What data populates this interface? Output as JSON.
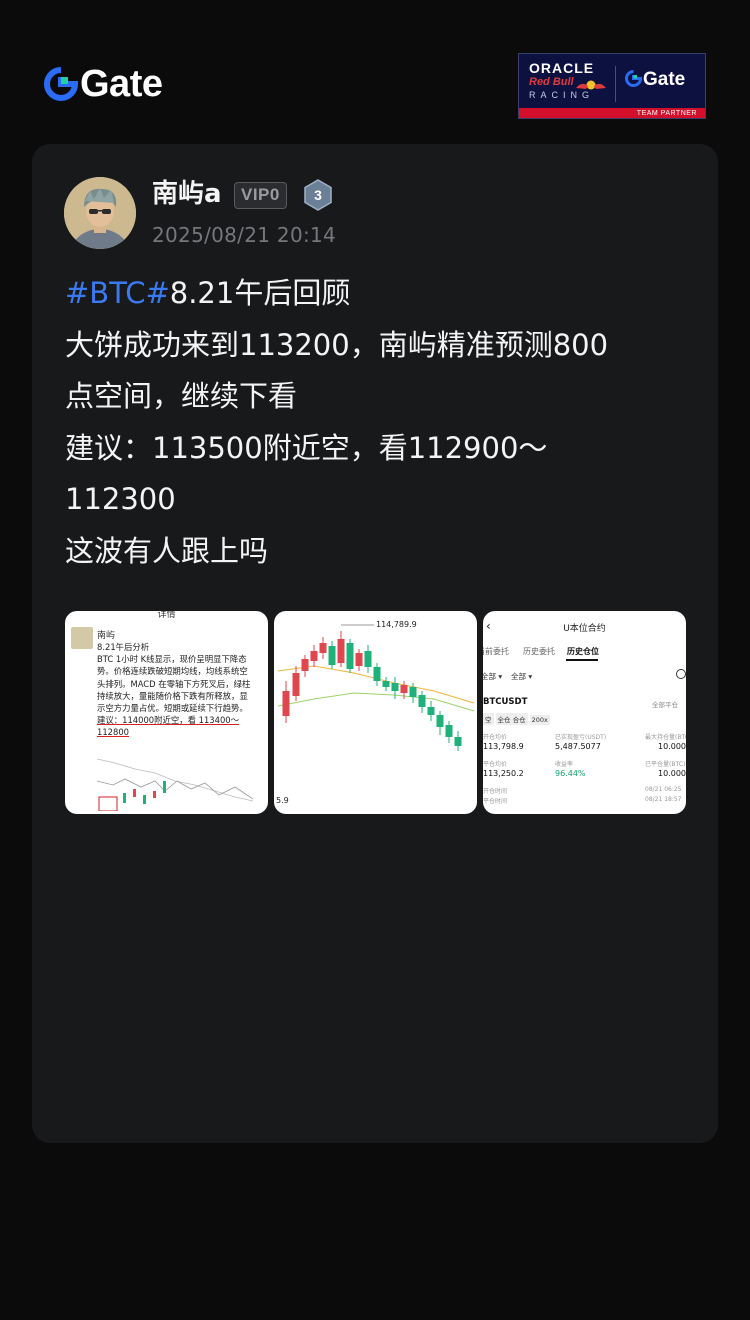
{
  "header": {
    "brand": "Gate",
    "partner": {
      "oracle": "ORACLE",
      "redbull": "Red Bull",
      "racing": "RACING",
      "gate": "Gate",
      "caption": "TEAM PARTNER"
    }
  },
  "post": {
    "username": "南屿a",
    "vip": "VIP0",
    "level": "3",
    "timestamp": "2025/08/21 20:14",
    "hashtag": "#BTC#",
    "lines": [
      "8.21午后回顾",
      "大饼成功来到113200，南屿精准预测800",
      "点空间，继续下看",
      "建议：113500附近空，看112900～",
      "112300",
      "这波有人跟上吗"
    ]
  },
  "thumbs": {
    "t1": {
      "top": "详情",
      "name": "南屿",
      "body_lines": [
        "8.21午后分析",
        "BTC 1小时 K线显示，现价呈明显下降态",
        "势。价格连续跌破短期均线，均线系统空",
        "头排列。MACD 在零轴下方死叉后，绿柱",
        "持续放大，量能随价格下跌有所释放，显",
        "示空方力量占优。短期或延续下行趋势。"
      ],
      "advice": "建议：114000附近空，看 113400～",
      "advice2": "112800"
    },
    "t2": {
      "peak": "114,789.9",
      "low": "5.9"
    },
    "t3": {
      "back": "‹",
      "title": "U本位合约",
      "tabs": [
        "当前委托",
        "历史委托",
        "历史仓位"
      ],
      "filters": [
        "全部 ▾",
        "全部 ▾"
      ],
      "fav": "全部平仓",
      "symbol": "BTCUSDT",
      "tags": [
        "空",
        "全仓 合仓",
        "200x"
      ],
      "labels": [
        "开仓均价",
        "已实现盈亏(USDT)",
        "最大持仓量(BTC)",
        "平仓均价",
        "收益率",
        "已平仓量(BTC)",
        "开仓时间",
        "平仓时间"
      ],
      "values": [
        "113,798.9",
        "5,487.5077",
        "10.000",
        "113,250.2",
        "96.44%",
        "10.000",
        "08/21 06:25",
        "08/21 18:57"
      ]
    }
  },
  "colors": {
    "background": "#0b0b0c",
    "card": "#18191b",
    "accent": "#3a7bf5",
    "up": "#e0464d",
    "down": "#1fb17a"
  }
}
